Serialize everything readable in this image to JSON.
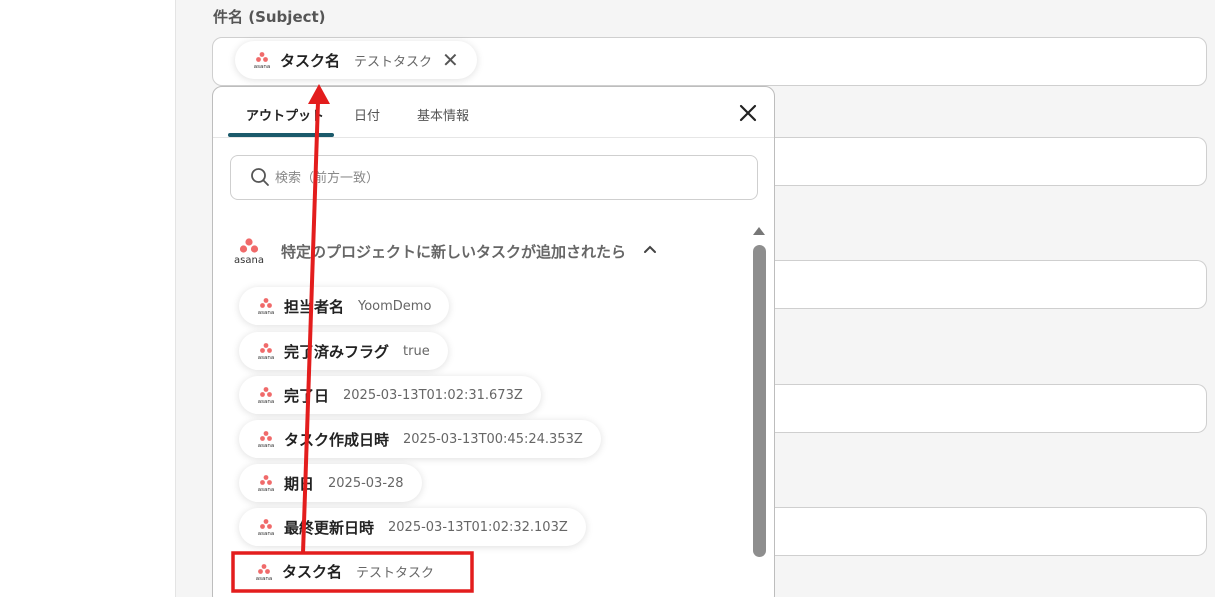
{
  "subject": {
    "label": "件名 (Subject)",
    "chip_key": "タスク名",
    "chip_value": "テストタスク",
    "chip_icon": "asana-logo"
  },
  "popup": {
    "tabs": [
      "アウトプット",
      "日付",
      "基本情報"
    ],
    "active_tab": "アウトプット",
    "search_placeholder": "検索（前方一致）",
    "section_title": "特定のプロジェクトに新しいタスクが追加されたら",
    "items": [
      {
        "key": "担当者名",
        "value": "YoomDemo"
      },
      {
        "key": "完了済みフラグ",
        "value": "true"
      },
      {
        "key": "完了日",
        "value": "2025-03-13T01:02:31.673Z"
      },
      {
        "key": "タスク作成日時",
        "value": "2025-03-13T00:45:24.353Z"
      },
      {
        "key": "期日",
        "value": "2025-03-28"
      },
      {
        "key": "最終更新日時",
        "value": "2025-03-13T01:02:32.103Z"
      },
      {
        "key": "タスク名",
        "value": "テストタスク"
      }
    ],
    "highlighted_item": "タスク名"
  },
  "colors": {
    "accent": "#1b5a6b",
    "annotation_red": "#e31d1d",
    "asana_coral": "#f06a6a"
  }
}
